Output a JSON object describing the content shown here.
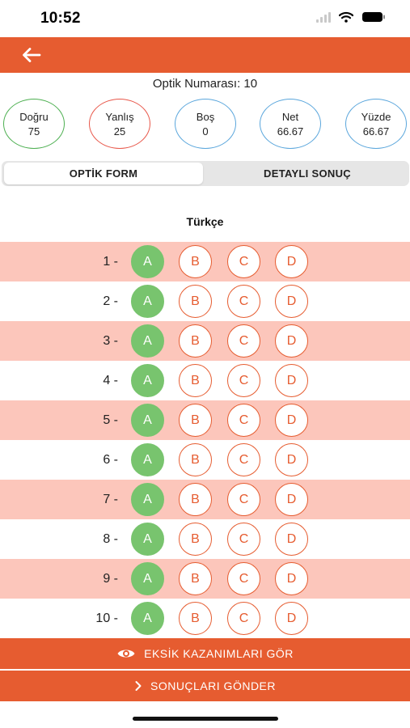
{
  "status_bar": {
    "time": "10:52"
  },
  "header": {
    "back_icon": "arrow-left-icon",
    "accent": "#e65c30"
  },
  "optik_label": "Optik Numarası: 10",
  "stats": [
    {
      "label": "Doğru",
      "value": "75",
      "color": "#4caf50"
    },
    {
      "label": "Yanlış",
      "value": "25",
      "color": "#e8574a"
    },
    {
      "label": "Boş",
      "value": "0",
      "color": "#5aa6dc"
    },
    {
      "label": "Net",
      "value": "66.67",
      "color": "#5aa6dc"
    },
    {
      "label": "Yüzde",
      "value": "66.67",
      "color": "#5aa6dc"
    }
  ],
  "tabs": {
    "optik_form": "OPTİK FORM",
    "detayli_sonuc": "DETAYLI SONUÇ",
    "active": "optik_form"
  },
  "section_title": "Türkçe",
  "options": [
    "A",
    "B",
    "C",
    "D"
  ],
  "questions": [
    {
      "number": "1 -",
      "selected": "A"
    },
    {
      "number": "2 -",
      "selected": "A"
    },
    {
      "number": "3 -",
      "selected": "A"
    },
    {
      "number": "4 -",
      "selected": "A"
    },
    {
      "number": "5 -",
      "selected": "A"
    },
    {
      "number": "6 -",
      "selected": "A"
    },
    {
      "number": "7 -",
      "selected": "A"
    },
    {
      "number": "8 -",
      "selected": "A"
    },
    {
      "number": "9 -",
      "selected": "A"
    },
    {
      "number": "10 -",
      "selected": "A"
    }
  ],
  "buttons": {
    "eksik_label": "EKSİK KAZANIMLARI GÖR",
    "eksik_icon": "eye-icon",
    "gonder_label": "SONUÇLARI GÖNDER",
    "gonder_icon": "chevron-right-icon"
  }
}
